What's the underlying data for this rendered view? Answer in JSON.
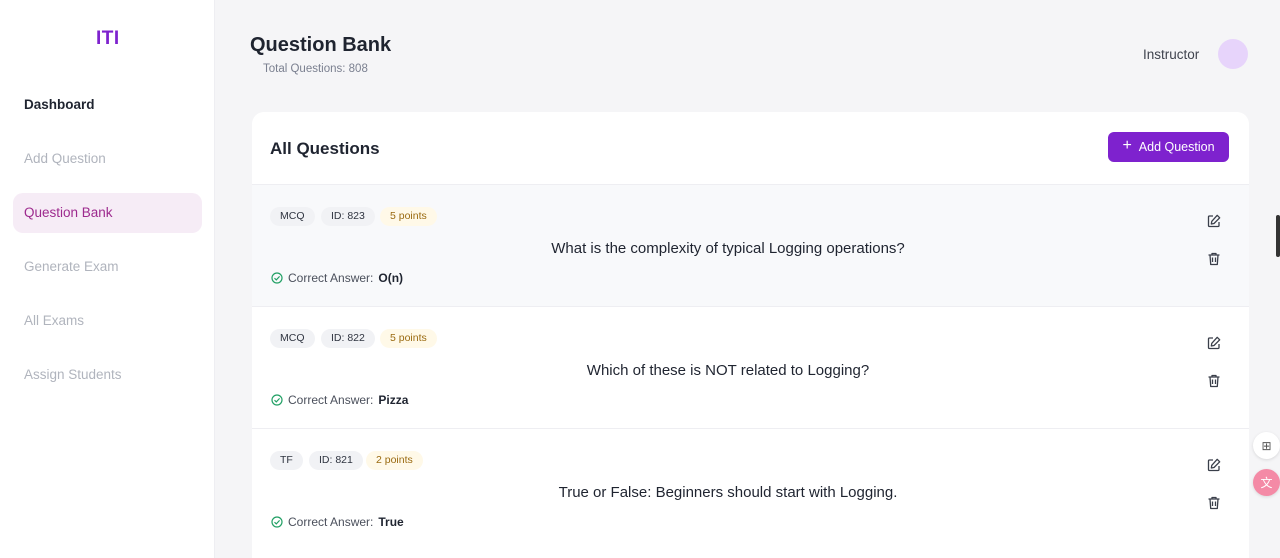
{
  "sidebar": {
    "logo": "ITI",
    "items": [
      {
        "label": "Dashboard"
      },
      {
        "label": "Add Question"
      },
      {
        "label": "Question Bank"
      },
      {
        "label": "Generate Exam"
      },
      {
        "label": "All Exams"
      },
      {
        "label": "Assign Students"
      }
    ]
  },
  "header": {
    "title": "Question Bank",
    "subtitle": "Total Questions: 808",
    "user": "Instructor"
  },
  "card": {
    "title": "All Questions",
    "add_label": "Add Question"
  },
  "questions": [
    {
      "type": "MCQ",
      "id": "ID: 823",
      "points": "5 points",
      "text": "What is the complexity of typical Logging operations?",
      "answer_label": "Correct Answer:",
      "answer": "O(n)"
    },
    {
      "type": "MCQ",
      "id": "ID: 822",
      "points": "5 points",
      "text": "Which of these is NOT related to Logging?",
      "answer_label": "Correct Answer:",
      "answer": "Pizza"
    },
    {
      "type": "TF",
      "id": "ID: 821",
      "points": "2 points",
      "text": "True or False: Beginners should start with Logging.",
      "answer_label": "Correct Answer:",
      "answer": "True"
    }
  ],
  "colors": {
    "accent": "#7e22ce",
    "active_nav_bg": "#f6ecf6",
    "active_nav_text": "#9d2a8e",
    "check_green": "#22a065"
  },
  "icons": {
    "add": "plus-icon",
    "edit": "edit-icon",
    "delete": "trash-icon",
    "answer": "check-circle-icon"
  }
}
